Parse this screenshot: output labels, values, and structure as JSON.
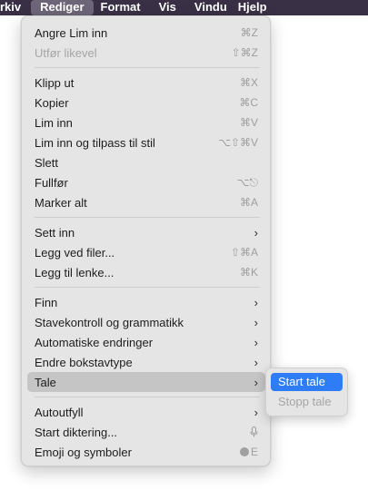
{
  "menubar": {
    "items": [
      "rkiv",
      "Rediger",
      "Format",
      "Vis",
      "Vindu",
      "Hjelp"
    ],
    "active": "Rediger"
  },
  "menu": {
    "sections": [
      [
        {
          "label": "Angre Lim inn",
          "shortcut": "⌘Z"
        },
        {
          "label": "Utfør likevel",
          "shortcut": "⇧⌘Z",
          "disabled": true
        }
      ],
      [
        {
          "label": "Klipp ut",
          "shortcut": "⌘X"
        },
        {
          "label": "Kopier",
          "shortcut": "⌘C"
        },
        {
          "label": "Lim inn",
          "shortcut": "⌘V"
        },
        {
          "label": "Lim inn og tilpass til stil",
          "shortcut": "⌥⇧⌘V"
        },
        {
          "label": "Slett",
          "shortcut": ""
        },
        {
          "label": "Fullfør",
          "shortcut": "⌥⎋"
        },
        {
          "label": "Marker alt",
          "shortcut": "⌘A"
        }
      ],
      [
        {
          "label": "Sett inn",
          "submenu": true
        },
        {
          "label": "Legg ved filer...",
          "shortcut": "⇧⌘A"
        },
        {
          "label": "Legg til lenke...",
          "shortcut": "⌘K"
        }
      ],
      [
        {
          "label": "Finn",
          "submenu": true
        },
        {
          "label": "Stavekontroll og grammatikk",
          "submenu": true
        },
        {
          "label": "Automatiske endringer",
          "submenu": true
        },
        {
          "label": "Endre bokstavtype",
          "submenu": true
        },
        {
          "label": "Tale",
          "submenu": true,
          "highlighted": true
        }
      ],
      [
        {
          "label": "Autoutfyll",
          "submenu": true
        },
        {
          "label": "Start diktering...",
          "shortcut": "🎙"
        },
        {
          "label": "Emoji og symboler",
          "shortcut": "🌐E"
        }
      ]
    ]
  },
  "submenu": {
    "parent": "Tale",
    "items": [
      {
        "label": "Start tale",
        "selected": true
      },
      {
        "label": "Stopp tale",
        "disabled": true
      }
    ]
  },
  "colors": {
    "menubar_bg": "#3a3046",
    "menu_bg": "#e6e5e5",
    "highlight_bg": "#c6c5c5",
    "selection_blue": "#2f7df6"
  }
}
